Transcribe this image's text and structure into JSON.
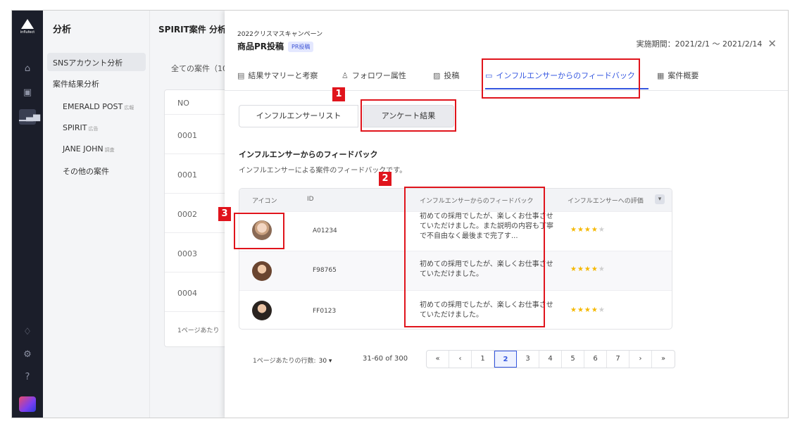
{
  "sidebar_rail": {
    "logo_text": "influfect",
    "icons": [
      "home-icon",
      "calendar-icon",
      "chart-icon",
      "bell-icon",
      "gear-icon",
      "help-icon"
    ]
  },
  "side": {
    "title": "分析",
    "items": [
      {
        "label": "SNSアカウント分析",
        "tag": ""
      },
      {
        "label": "案件結果分析",
        "tag": ""
      },
      {
        "label": "EMERALD POST",
        "tag": "広報"
      },
      {
        "label": "SPIRIT",
        "tag": "広告"
      },
      {
        "label": "JANE JOHN",
        "tag": "調査"
      },
      {
        "label": "その他の案件",
        "tag": ""
      }
    ]
  },
  "background": {
    "title": "SPIRIT案件 分析",
    "all_cases": "全ての案件（10",
    "no_header": "NO",
    "rows": [
      "0001",
      "0001",
      "0002",
      "0003",
      "0004"
    ],
    "footer": "1ページあたり"
  },
  "modal": {
    "campaign": "2022クリスマスキャンペーン",
    "title": "商品PR投稿",
    "badge": "PR投稿",
    "period": "実施期間：2021/2/1 〜 2021/2/14",
    "close": "✕",
    "tabs": [
      {
        "label": "結果サマリーと考察",
        "icon": "document-icon"
      },
      {
        "label": "フォロワー属性",
        "icon": "users-icon"
      },
      {
        "label": "投稿",
        "icon": "image-icon"
      },
      {
        "label": "インフルエンサーからのフィードバック",
        "icon": "feedback-icon"
      },
      {
        "label": "案件概要",
        "icon": "calendar-icon"
      }
    ],
    "segments": [
      "インフルエンサーリスト",
      "アンケート結果"
    ],
    "section_title": "インフルエンサーからのフィードバック",
    "section_desc": "インフルエンサーによる案件のフィードバックです。",
    "table": {
      "headers": [
        "アイコン",
        "ID",
        "インフルエンサーからのフィードバック",
        "インフルエンサーへの評価"
      ],
      "rows": [
        {
          "id": "A01234",
          "feedback": "初めての採用でしたが、楽しくお仕事させていただけました。また説明の内容も丁寧で不自由なく最後まで完了す...",
          "rating": 4,
          "max": 5
        },
        {
          "id": "F98765",
          "feedback": "初めての採用でしたが、楽しくお仕事させていただけました。",
          "rating": 4,
          "max": 5
        },
        {
          "id": "FF0123",
          "feedback": "初めての採用でしたが、楽しくお仕事させていただけました。",
          "rating": 4,
          "max": 5
        }
      ]
    },
    "pager": {
      "rows_label": "1ページあたりの行数:",
      "rows_value": "30 ▾",
      "range": "31-60 of 300",
      "buttons": [
        "«",
        "‹",
        "1",
        "2",
        "3",
        "4",
        "5",
        "6",
        "7",
        "›",
        "»"
      ],
      "active": "2"
    }
  },
  "annotations": [
    "1",
    "2",
    "3"
  ],
  "colors": {
    "accent": "#3557e0",
    "annotation": "#e0141c",
    "star": "#f5b800",
    "rail": "#1b1e2a"
  }
}
